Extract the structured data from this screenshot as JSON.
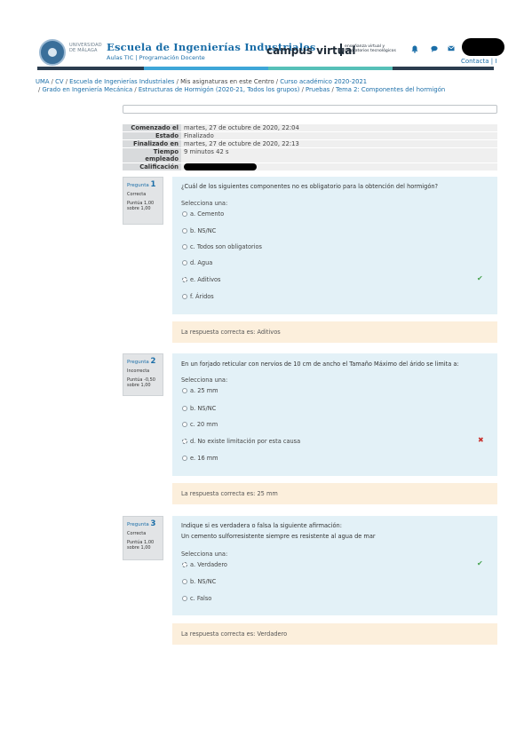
{
  "header": {
    "university": "UNIVERSIDAD DE MÁLAGA",
    "school": "Escuela de Ingenierías Industriales",
    "aulas_tic": "Aulas TIC",
    "programacion": "Programación Docente",
    "campus": "campus virtual",
    "campus_sub": "enseñanza virtual y laboratorios tecnológicos",
    "contact": "Contacta | I",
    "icons": [
      "bell-icon",
      "chat-icon",
      "mail-icon"
    ],
    "bar_colors": [
      "#2b3d4f",
      "#3ea6d8",
      "#56c0b8",
      "#2b3d4f"
    ]
  },
  "breadcrumb": {
    "line1": [
      "UMA",
      "CV",
      "Escuela de Ingenierías Industriales",
      "Mis asignaturas en este Centro",
      "Curso académico 2020-2021"
    ],
    "line2": [
      "Grado en Ingeniería Mecánica",
      "Estructuras de Hormigón (2020-21, Todos los grupos)",
      "Pruebas",
      "Tema 2: Componentes del hormigón"
    ]
  },
  "summary": {
    "comenzado_label": "Comenzado el",
    "comenzado_value": "martes, 27 de octubre de 2020, 22:04",
    "estado_label": "Estado",
    "estado_value": "Finalizado",
    "finalizado_label": "Finalizado en",
    "finalizado_value": "martes, 27 de octubre de 2020, 22:13",
    "tiempo_label_1": "Tiempo",
    "tiempo_label_2": "empleado",
    "tiempo_value": "9 minutos 42 s",
    "calificacion_label": "Calificación"
  },
  "questions": [
    {
      "label": "Pregunta",
      "number": "1",
      "state": "Correcta",
      "points": "Puntúa 1,00 sobre 1,00",
      "text": "¿Cuál de los siguientes componentes no es obligatorio para la obtención del hormigón?",
      "prompt": "Selecciona una:",
      "options": [
        "a. Cemento",
        "b. NS/NC",
        "c. Todos son obligatorios",
        "d. Agua",
        "e. Aditivos",
        "f. Áridos"
      ],
      "selected": 4,
      "mark": "correct",
      "feedback": "La respuesta correcta es: Aditivos"
    },
    {
      "label": "Pregunta",
      "number": "2",
      "state": "Incorrecta",
      "points": "Puntúa -0,50 sobre 1,00",
      "text": "En un forjado reticular con nervios de 10 cm de ancho el Tamaño Máximo del árido se limita a:",
      "prompt": "Selecciona una:",
      "options": [
        "a. 25 mm",
        "b. NS/NC",
        "c. 20 mm",
        "d. No existe limitación por esta causa",
        "e. 16 mm"
      ],
      "selected": 3,
      "mark": "incorrect",
      "feedback": "La respuesta correcta es: 25 mm"
    },
    {
      "label": "Pregunta",
      "number": "3",
      "state": "Correcta",
      "points": "Puntúa 1,00 sobre 1,00",
      "text": "Indique si es verdadera o falsa la siguiente afirmación:",
      "text2": "Un cemento sulforresistente siempre es resistente al agua de mar",
      "prompt": "Selecciona una:",
      "options": [
        "a. Verdadero",
        "b. NS/NC",
        "c. Falso"
      ],
      "selected": 0,
      "mark": "correct",
      "feedback": "La respuesta correcta es: Verdadero"
    }
  ]
}
